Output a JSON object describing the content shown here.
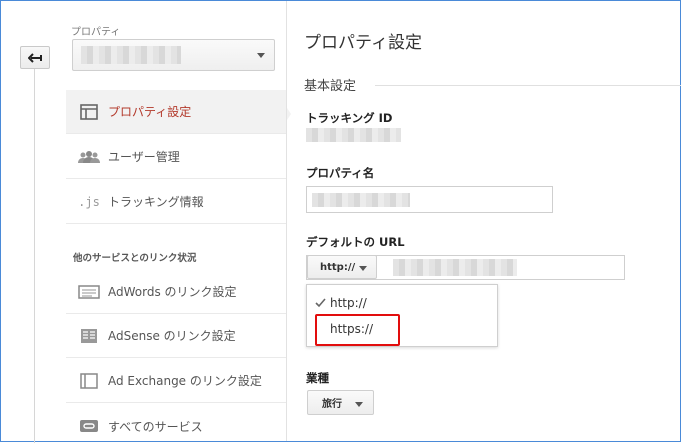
{
  "sidebar": {
    "property_label": "プロパティ",
    "items": [
      {
        "label": "プロパティ設定",
        "icon": "property-settings-icon"
      },
      {
        "label": "ユーザー管理",
        "icon": "users-icon"
      },
      {
        "label": "トラッキング情報",
        "icon": "js-icon"
      }
    ],
    "section_header": "他のサービスとのリンク状況",
    "links": [
      {
        "label": "AdWords のリンク設定",
        "icon": "adwords-icon"
      },
      {
        "label": "AdSense のリンク設定",
        "icon": "adsense-icon"
      },
      {
        "label": "Ad Exchange のリンク設定",
        "icon": "ad-exchange-icon"
      },
      {
        "label": "すべてのサービス",
        "icon": "link-icon"
      }
    ]
  },
  "main": {
    "title": "プロパティ設定",
    "section_title": "基本設定",
    "tracking_id_label": "トラッキング ID",
    "property_name_label": "プロパティ名",
    "default_url_label": "デフォルトの URL",
    "protocol_selected": "http://",
    "protocol_options": [
      "http://",
      "https://"
    ],
    "industry_label": "業種",
    "industry_value": "旅行"
  },
  "colors": {
    "accent": "#b3392b",
    "highlight": "#e20d0d",
    "border": "#4a8ad8"
  }
}
